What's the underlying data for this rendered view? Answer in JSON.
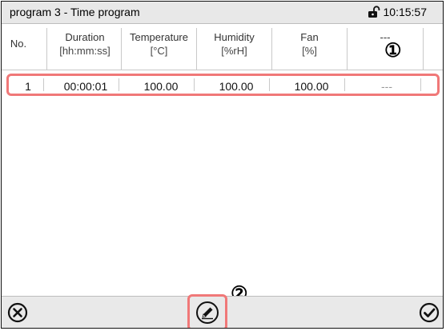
{
  "header": {
    "title": "program 3 - Time program",
    "time": "10:15:57",
    "lock_icon": "lock-open-icon"
  },
  "table": {
    "columns": [
      {
        "label": "No.",
        "unit": ""
      },
      {
        "label": "Duration",
        "unit": "[hh:mm:ss]"
      },
      {
        "label": "Temperature",
        "unit": "[°C]"
      },
      {
        "label": "Humidity",
        "unit": "[%rH]"
      },
      {
        "label": "Fan",
        "unit": "[%]"
      },
      {
        "label": "---",
        "unit": ""
      }
    ],
    "rows": [
      {
        "no": "1",
        "duration": "00:00:01",
        "temperature": "100.00",
        "humidity": "100.00",
        "fan": "100.00",
        "extra": "---"
      }
    ]
  },
  "annotations": {
    "marker1": "①",
    "marker2": "②"
  },
  "toolbar": {
    "cancel_icon": "close-circle-icon",
    "edit_icon": "edit-pencil-icon",
    "confirm_icon": "checkmark-circle-icon"
  },
  "colors": {
    "highlight": "#f07878",
    "bar_bg": "#e9e9e9"
  }
}
